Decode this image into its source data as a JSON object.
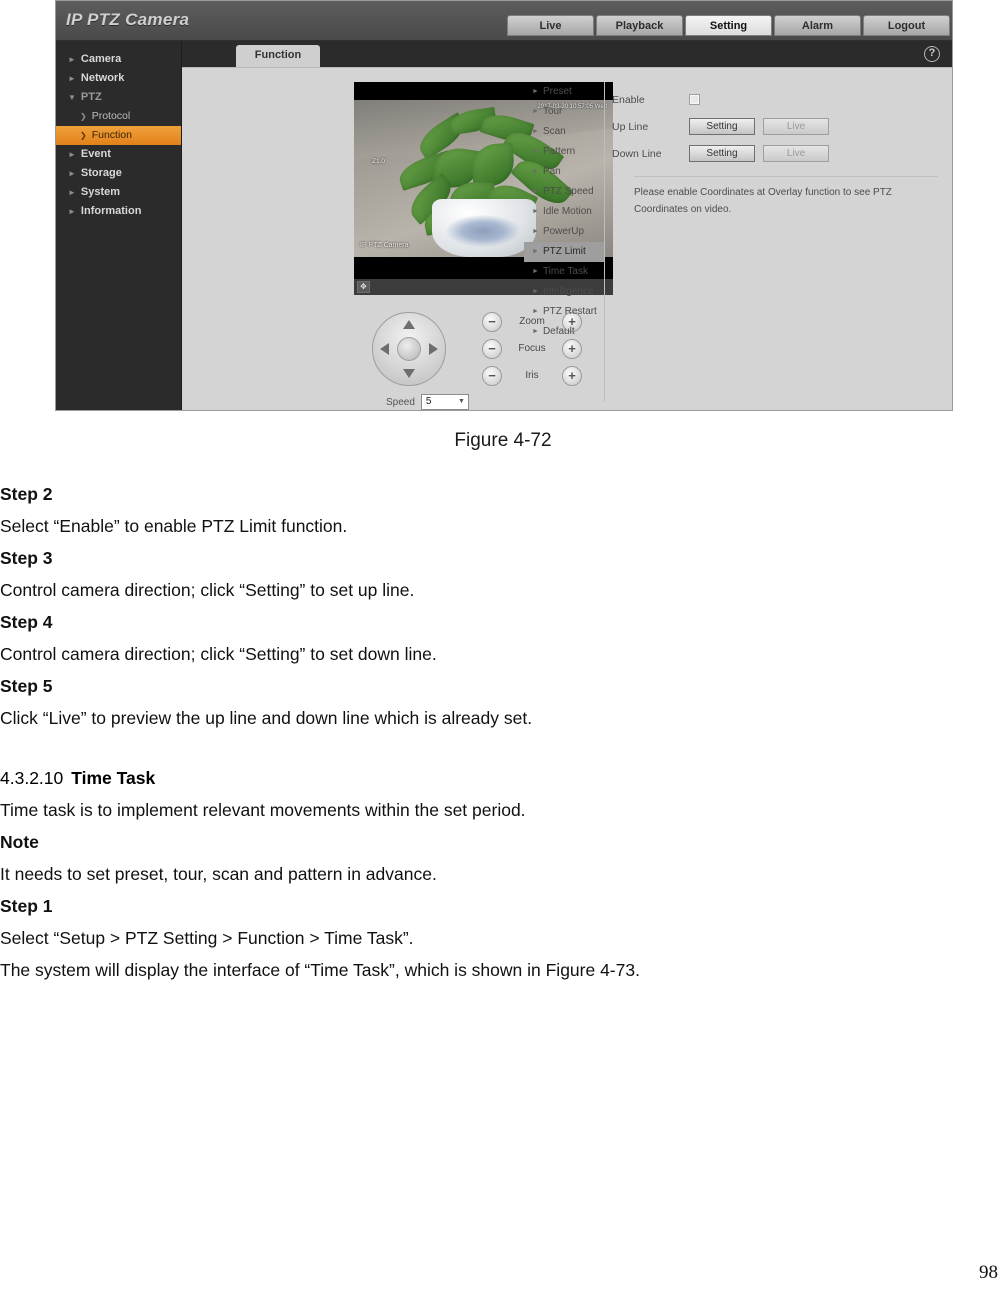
{
  "screenshot": {
    "brand": "IP PTZ Camera",
    "nav": [
      {
        "label": "Live",
        "active": false
      },
      {
        "label": "Playback",
        "active": false
      },
      {
        "label": "Setting",
        "active": true
      },
      {
        "label": "Alarm",
        "active": false
      },
      {
        "label": "Logout",
        "active": false
      }
    ],
    "sidebar": [
      {
        "label": "Camera",
        "level": "top",
        "state": "normal"
      },
      {
        "label": "Network",
        "level": "top",
        "state": "normal"
      },
      {
        "label": "PTZ",
        "level": "top",
        "state": "expanded"
      },
      {
        "label": "Protocol",
        "level": "sub",
        "state": "normal"
      },
      {
        "label": "Function",
        "level": "sub",
        "state": "active"
      },
      {
        "label": "Event",
        "level": "top",
        "state": "normal"
      },
      {
        "label": "Storage",
        "level": "top",
        "state": "normal"
      },
      {
        "label": "System",
        "level": "top",
        "state": "normal"
      },
      {
        "label": "Information",
        "level": "top",
        "state": "normal"
      }
    ],
    "tab": "Function",
    "help_icon": "?",
    "video": {
      "osd_time": "2017-03-30 10:57:05 Wed",
      "osd_zoom": "Z1.0",
      "osd_name": "IP PTZ Camera",
      "fullscreen_icon": "fullscreen-icon"
    },
    "ptz": {
      "lens_rows": [
        {
          "label": "Zoom",
          "minus": "−",
          "plus": "+"
        },
        {
          "label": "Focus",
          "minus": "−",
          "plus": "+"
        },
        {
          "label": "Iris",
          "minus": "−",
          "plus": "+"
        }
      ],
      "speed_label": "Speed",
      "speed_value": "5"
    },
    "functions": [
      {
        "label": "Preset",
        "active": false
      },
      {
        "label": "Tour",
        "active": false
      },
      {
        "label": "Scan",
        "active": false
      },
      {
        "label": "Pattern",
        "active": false
      },
      {
        "label": "Pan",
        "active": false
      },
      {
        "label": "PTZ Speed",
        "active": false
      },
      {
        "label": "Idle Motion",
        "active": false
      },
      {
        "label": "PowerUp",
        "active": false
      },
      {
        "label": "PTZ Limit",
        "active": true
      },
      {
        "label": "Time Task",
        "active": false
      },
      {
        "label": "Intelligence",
        "active": false
      },
      {
        "label": "PTZ Restart",
        "active": false
      },
      {
        "label": "Default",
        "active": false
      }
    ],
    "form": {
      "enable_label": "Enable",
      "enable_checked": false,
      "up_line_label": "Up Line",
      "down_line_label": "Down Line",
      "setting_label": "Setting",
      "live_label": "Live",
      "hint": "Please enable Coordinates at Overlay function to see PTZ Coordinates on video."
    },
    "colors": {
      "accent": "#e2811a",
      "panel": "#d4d4d4",
      "sidebar": "#2b2b2b",
      "titlebar": "#4a4a4a"
    }
  },
  "document": {
    "figure_caption": "Figure 4-72",
    "blocks": [
      {
        "type": "bold",
        "text": "Step 2"
      },
      {
        "type": "text",
        "text": "Select “Enable” to enable PTZ Limit function."
      },
      {
        "type": "bold",
        "text": "Step 3"
      },
      {
        "type": "text",
        "text": "Control camera direction; click “Setting” to set up line."
      },
      {
        "type": "bold",
        "text": "Step 4"
      },
      {
        "type": "text",
        "text": "Control camera direction; click “Setting” to set down line."
      },
      {
        "type": "bold",
        "text": "Step 5"
      },
      {
        "type": "text",
        "text": "Click “Live” to preview the up line and down line which is already set."
      },
      {
        "type": "gap",
        "text": ""
      },
      {
        "type": "section",
        "number": "4.3.2.10",
        "title": "Time Task"
      },
      {
        "type": "text",
        "text": "Time task is to implement relevant movements within the set period."
      },
      {
        "type": "bold",
        "text": "Note"
      },
      {
        "type": "highlight",
        "text": "It needs to set preset, tour, scan and pattern in advance."
      },
      {
        "type": "bold",
        "text": "Step 1"
      },
      {
        "type": "text",
        "text": "Select “Setup > PTZ Setting > Function > Time Task”."
      },
      {
        "type": "text",
        "text": "The system will display the interface of “Time Task”, which is shown in Figure 4-73."
      }
    ],
    "page_number": "98"
  }
}
